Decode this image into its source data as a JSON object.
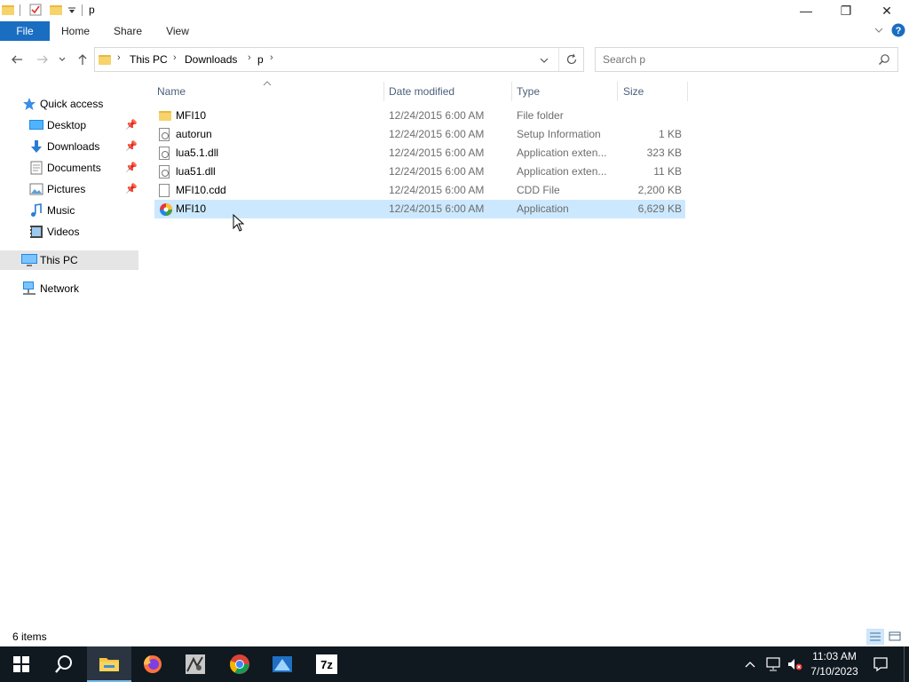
{
  "titlebar": {
    "title": "p",
    "minimize_glyph": "—",
    "restore_glyph": "❐",
    "close_glyph": "✕"
  },
  "ribbon": {
    "tabs": [
      {
        "label": "File"
      },
      {
        "label": "Home"
      },
      {
        "label": "Share"
      },
      {
        "label": "View"
      }
    ]
  },
  "address": {
    "breadcrumbs": [
      "This PC",
      "Downloads",
      "p"
    ]
  },
  "search": {
    "placeholder": "Search p"
  },
  "sidebar": {
    "items": [
      {
        "label": "Quick access",
        "icon": "star-icon"
      },
      {
        "label": "Desktop",
        "icon": "desktop-icon",
        "pinned": true
      },
      {
        "label": "Downloads",
        "icon": "download-icon",
        "pinned": true
      },
      {
        "label": "Documents",
        "icon": "documents-icon",
        "pinned": true
      },
      {
        "label": "Pictures",
        "icon": "pictures-icon",
        "pinned": true
      },
      {
        "label": "Music",
        "icon": "music-icon"
      },
      {
        "label": "Videos",
        "icon": "videos-icon"
      },
      {
        "label": "This PC",
        "icon": "computer-icon",
        "selected": true
      },
      {
        "label": "Network",
        "icon": "network-icon"
      }
    ]
  },
  "filelist": {
    "columns": [
      "Name",
      "Date modified",
      "Type",
      "Size"
    ],
    "rows": [
      {
        "name": "MFI10",
        "date": "12/24/2015 6:00 AM",
        "type": "File folder",
        "size": "",
        "icon": "folder-icon"
      },
      {
        "name": "autorun",
        "date": "12/24/2015 6:00 AM",
        "type": "Setup Information",
        "size": "1 KB",
        "icon": "setup-info-icon"
      },
      {
        "name": "lua5.1.dll",
        "date": "12/24/2015 6:00 AM",
        "type": "Application exten...",
        "size": "323 KB",
        "icon": "dll-icon"
      },
      {
        "name": "lua51.dll",
        "date": "12/24/2015 6:00 AM",
        "type": "Application exten...",
        "size": "11 KB",
        "icon": "dll-icon"
      },
      {
        "name": "MFI10.cdd",
        "date": "12/24/2015 6:00 AM",
        "type": "CDD File",
        "size": "2,200 KB",
        "icon": "file-icon"
      },
      {
        "name": "MFI10",
        "date": "12/24/2015 6:00 AM",
        "type": "Application",
        "size": "6,629 KB",
        "icon": "app-icon",
        "selected": true
      }
    ]
  },
  "statusbar": {
    "item_count": "6 items"
  },
  "taskbar": {
    "apps": [
      "start-icon",
      "search-icon",
      "file-explorer-icon",
      "firefox-icon",
      "app-icon",
      "chrome-icon",
      "app-icon",
      "7zip-icon"
    ],
    "sevenzip_label": "7z",
    "time": "11:03 AM",
    "date": "7/10/2023"
  },
  "colors": {
    "accent": "#1a6ec2",
    "selected_row": "#cce8ff",
    "taskbar": "#101820"
  }
}
